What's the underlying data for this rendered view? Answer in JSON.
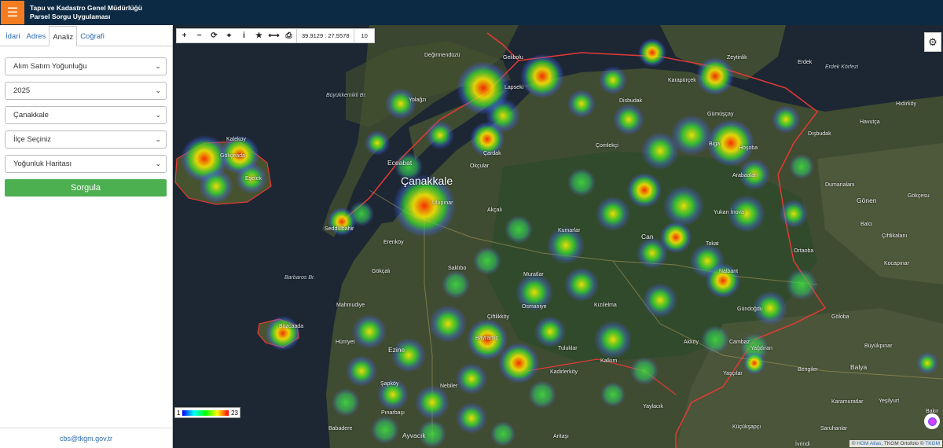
{
  "header": {
    "menu_icon": "hamburger-icon",
    "title_line1": "Tapu ve Kadastro Genel Müdürlüğü",
    "title_line2": "Parsel Sorgu Uygulaması",
    "menu_color": "#f47c20",
    "bar_color": "#0d2a44"
  },
  "sidebar": {
    "tabs": [
      {
        "label": "İdari",
        "active": false
      },
      {
        "label": "Adres",
        "active": false
      },
      {
        "label": "Analiz",
        "active": true
      },
      {
        "label": "Coğrafi",
        "active": false
      }
    ],
    "selects": [
      {
        "value": "Alım Satım Yoğunluğu"
      },
      {
        "value": "2025"
      },
      {
        "value": "Çanakkale"
      },
      {
        "value": "İlçe Seçiniz"
      },
      {
        "value": "Yoğunluk Haritası"
      }
    ],
    "submit_label": "Sorgula",
    "submit_color": "#4caf50",
    "footer_email": "cbs@tkgm.gov.tr"
  },
  "map": {
    "toolbar_icons": [
      "plus-icon",
      "minus-icon",
      "refresh-icon",
      "locate-icon",
      "info-icon",
      "star-icon",
      "measure-icon",
      "print-icon"
    ],
    "toolbar_glyphs": [
      "+",
      "−",
      "⟳",
      "⌖",
      "i",
      "★",
      "⟷",
      "⎙"
    ],
    "coordinates": "39.9129 : 27.5578",
    "zoom": "10",
    "legend_min": "1",
    "legend_max": "23",
    "attribution_prefix": "©",
    "attribution_hgm": "HGM Atlas",
    "attribution_mid": ", TKGM Ortofoto ©",
    "attribution_tkgm": "TKGM",
    "places": [
      {
        "name": "Çanakkale",
        "cls": "big"
      },
      {
        "name": "Değirmendüzü",
        "cls": ""
      },
      {
        "name": "Gelibolu",
        "cls": ""
      },
      {
        "name": "Lapseki",
        "cls": ""
      },
      {
        "name": "Zeytinlik",
        "cls": ""
      },
      {
        "name": "Erdek",
        "cls": ""
      },
      {
        "name": "Erdek Körfezi",
        "cls": "it"
      },
      {
        "name": "Büyükkemikli Br.",
        "cls": "it"
      },
      {
        "name": "Yolağzı",
        "cls": ""
      },
      {
        "name": "Kalekoy",
        "cls": ""
      },
      {
        "name": "Gökçeada",
        "cls": ""
      },
      {
        "name": "Eşelek",
        "cls": ""
      },
      {
        "name": "Eceabat",
        "cls": "med"
      },
      {
        "name": "Seddülbahir",
        "cls": ""
      },
      {
        "name": "Ulupınar",
        "cls": ""
      },
      {
        "name": "Akçalı",
        "cls": ""
      },
      {
        "name": "Okçular",
        "cls": ""
      },
      {
        "name": "Çardak",
        "cls": ""
      },
      {
        "name": "Disbudak",
        "cls": ""
      },
      {
        "name": "Çomlekçi",
        "cls": ""
      },
      {
        "name": "Kumarlar",
        "cls": ""
      },
      {
        "name": "Erenköy",
        "cls": ""
      },
      {
        "name": "Gökçalı",
        "cls": ""
      },
      {
        "name": "Barbaros Br.",
        "cls": "it"
      },
      {
        "name": "Mahmudiye",
        "cls": ""
      },
      {
        "name": "Bozcaada",
        "cls": ""
      },
      {
        "name": "Hürriyet",
        "cls": ""
      },
      {
        "name": "Ezine",
        "cls": "med"
      },
      {
        "name": "Şapköy",
        "cls": ""
      },
      {
        "name": "Nebiler",
        "cls": ""
      },
      {
        "name": "Pınarbaşı",
        "cls": ""
      },
      {
        "name": "Babadere",
        "cls": ""
      },
      {
        "name": "Ayvacık",
        "cls": "med"
      },
      {
        "name": "Can",
        "cls": "med"
      },
      {
        "name": "Karapürçek",
        "cls": ""
      },
      {
        "name": "Gümüşçay",
        "cls": ""
      },
      {
        "name": "Biga",
        "cls": ""
      },
      {
        "name": "Hoşoba",
        "cls": ""
      },
      {
        "name": "Dışbudak",
        "cls": ""
      },
      {
        "name": "Arabaalan",
        "cls": ""
      },
      {
        "name": "Dumanalanı",
        "cls": ""
      },
      {
        "name": "Gönen",
        "cls": "med"
      },
      {
        "name": "Gökçesu",
        "cls": ""
      },
      {
        "name": "Hıdırköy",
        "cls": ""
      },
      {
        "name": "Havutça",
        "cls": ""
      },
      {
        "name": "Balcı",
        "cls": ""
      },
      {
        "name": "Çiftlikalanı",
        "cls": ""
      },
      {
        "name": "Ortaoba",
        "cls": ""
      },
      {
        "name": "Kocapınar",
        "cls": ""
      },
      {
        "name": "Yukarı İnova",
        "cls": ""
      },
      {
        "name": "Nalbant",
        "cls": ""
      },
      {
        "name": "Tokat",
        "cls": ""
      },
      {
        "name": "Gündoğdu",
        "cls": ""
      },
      {
        "name": "Göloba",
        "cls": ""
      },
      {
        "name": "Akköy",
        "cls": ""
      },
      {
        "name": "Cambaz",
        "cls": ""
      },
      {
        "name": "Bengiler",
        "cls": ""
      },
      {
        "name": "Balya",
        "cls": "med"
      },
      {
        "name": "Büyükpınar",
        "cls": ""
      },
      {
        "name": "Yağdıran",
        "cls": ""
      },
      {
        "name": "Yaşçılar",
        "cls": ""
      },
      {
        "name": "Kızılelma",
        "cls": ""
      },
      {
        "name": "Osmaniye",
        "cls": ""
      },
      {
        "name": "Tuluklar",
        "cls": ""
      },
      {
        "name": "Bayramiç",
        "cls": ""
      },
      {
        "name": "Çiftlikköy",
        "cls": ""
      },
      {
        "name": "Küçükşapçı",
        "cls": ""
      },
      {
        "name": "Aritaşı",
        "cls": ""
      },
      {
        "name": "Yaylacık",
        "cls": ""
      },
      {
        "name": "İvrindi",
        "cls": ""
      },
      {
        "name": "Bakır",
        "cls": ""
      },
      {
        "name": "Yeşilyurt",
        "cls": ""
      },
      {
        "name": "Kadirlerköy",
        "cls": ""
      },
      {
        "name": "Kalkım",
        "cls": ""
      },
      {
        "name": "Saruhanlar",
        "cls": ""
      },
      {
        "name": "Karamuratlar",
        "cls": ""
      },
      {
        "name": "Muratlar",
        "cls": ""
      },
      {
        "name": "Saklıbo",
        "cls": ""
      }
    ]
  }
}
